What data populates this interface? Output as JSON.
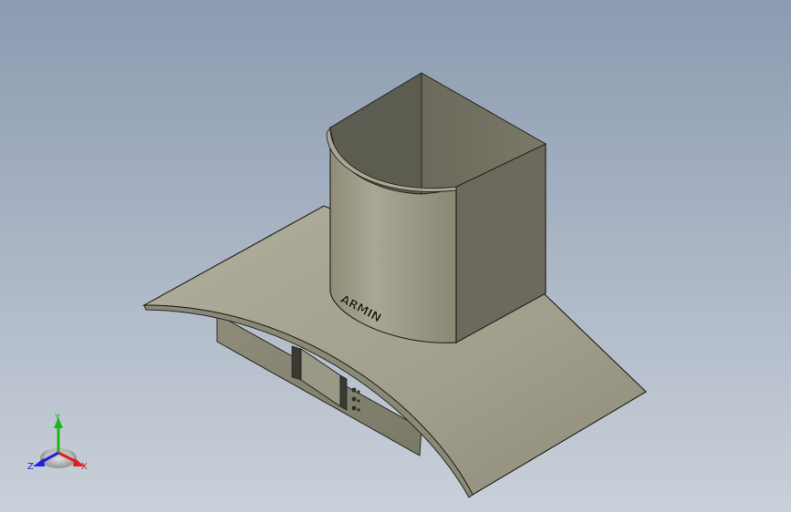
{
  "viewport": {
    "background_top": "#8d9cb2",
    "background_bottom": "#c8cfd8"
  },
  "model": {
    "brand_text": "ARMIN",
    "body_color": "#a4a28e",
    "edge_color": "#26261f"
  },
  "triad": {
    "x_label": "X",
    "y_label": "Y",
    "z_label": "Z",
    "x_color": "#e02020",
    "y_color": "#18b818",
    "z_color": "#2020e0"
  }
}
